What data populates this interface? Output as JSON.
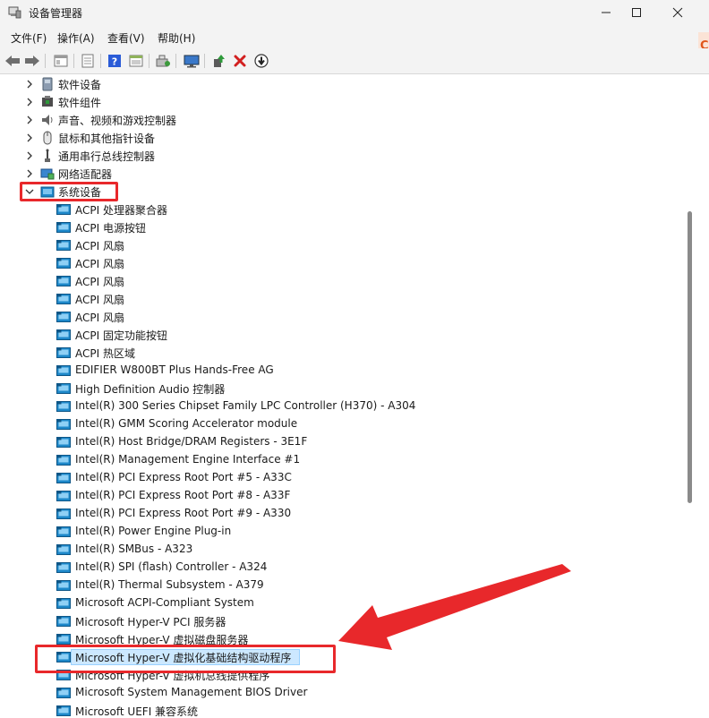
{
  "window": {
    "title": "设备管理器",
    "controls": [
      "minimize",
      "maximize",
      "close"
    ]
  },
  "menu": [
    {
      "label": "文件(F)"
    },
    {
      "label": "操作(A)"
    },
    {
      "label": "查看(V)"
    },
    {
      "label": "帮助(H)"
    }
  ],
  "toolbar": {
    "buttons": [
      "back-icon",
      "forward-icon",
      "properties-icon",
      "properties-sheet-icon",
      "help-icon",
      "view-icon",
      "scan-hardware-icon",
      "monitor-icon",
      "update-driver-icon",
      "uninstall-icon",
      "disable-icon"
    ]
  },
  "side_fragment": {
    "text": "C"
  },
  "tree": {
    "categories": [
      {
        "label": "软件设备",
        "expanded": false,
        "icon": "software-device-icon"
      },
      {
        "label": "软件组件",
        "expanded": false,
        "icon": "software-component-icon"
      },
      {
        "label": "声音、视频和游戏控制器",
        "expanded": false,
        "icon": "speaker-icon"
      },
      {
        "label": "鼠标和其他指针设备",
        "expanded": false,
        "icon": "mouse-icon"
      },
      {
        "label": "通用串行总线控制器",
        "expanded": false,
        "icon": "usb-icon"
      },
      {
        "label": "网络适配器",
        "expanded": false,
        "icon": "network-adapter-icon"
      },
      {
        "label": "系统设备",
        "expanded": true,
        "icon": "system-devices-icon"
      }
    ],
    "system_devices": [
      "ACPI 处理器聚合器",
      "ACPI 电源按钮",
      "ACPI 风扇",
      "ACPI 风扇",
      "ACPI 风扇",
      "ACPI 风扇",
      "ACPI 风扇",
      "ACPI 固定功能按钮",
      "ACPI 热区域",
      "EDIFIER W800BT Plus Hands-Free AG",
      "High Definition Audio 控制器",
      "Intel(R) 300 Series Chipset Family LPC Controller (H370) - A304",
      "Intel(R) GMM Scoring Accelerator module",
      "Intel(R) Host Bridge/DRAM Registers - 3E1F",
      "Intel(R) Management Engine Interface #1",
      "Intel(R) PCI Express Root Port #5 - A33C",
      "Intel(R) PCI Express Root Port #8 - A33F",
      "Intel(R) PCI Express Root Port #9 - A330",
      "Intel(R) Power Engine Plug-in",
      "Intel(R) SMBus - A323",
      "Intel(R) SPI (flash) Controller - A324",
      "Intel(R) Thermal Subsystem - A379",
      "Microsoft ACPI-Compliant System",
      "Microsoft Hyper-V PCI 服务器",
      "Microsoft Hyper-V 虚拟磁盘服务器",
      "Microsoft Hyper-V 虚拟化基础结构驱动程序",
      "Microsoft Hyper-V 虚拟机总线提供程序",
      "Microsoft System Management BIOS Driver",
      "Microsoft UEFI 兼容系统"
    ],
    "selected": "Microsoft Hyper-V 虚拟化基础结构驱动程序"
  },
  "colors": {
    "selection_bg": "#cce8ff",
    "selection_border": "#99d1ff",
    "annotation": "#e8282b",
    "device_icon": "#1e88c9"
  }
}
